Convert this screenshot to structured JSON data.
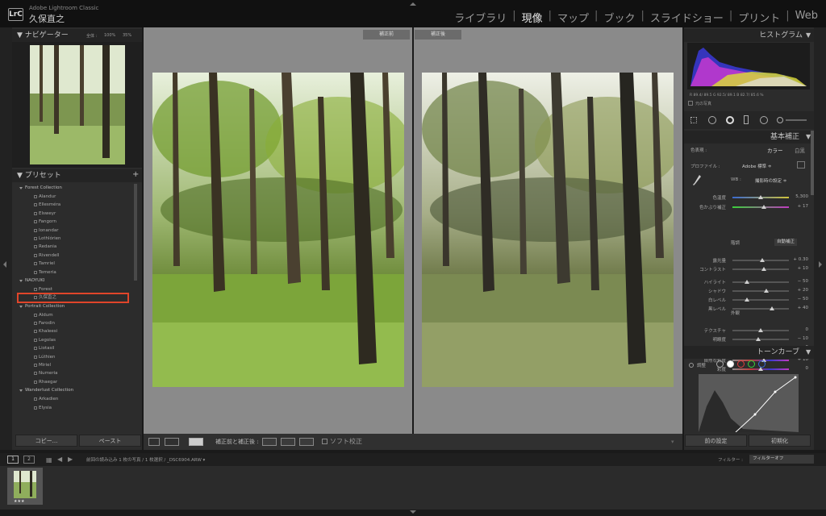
{
  "app": {
    "logo": "LrC",
    "name": "Adobe Lightroom Classic",
    "user": "久保直之"
  },
  "modules": [
    {
      "label": "ライブラリ",
      "active": false
    },
    {
      "label": "現像",
      "active": true
    },
    {
      "label": "マップ",
      "active": false
    },
    {
      "label": "ブック",
      "active": false
    },
    {
      "label": "スライドショー",
      "active": false
    },
    {
      "label": "プリント",
      "active": false
    },
    {
      "label": "Web",
      "active": false
    }
  ],
  "navigator": {
    "title": "ナビゲーター",
    "zoom_fit": "全体 :",
    "zoom_100": "100%",
    "zoom_35": "35%"
  },
  "presets": {
    "title": "プリセット",
    "add": "+",
    "groups": [
      {
        "name": "Forest Collection",
        "items": [
          "Alandur",
          "Ellesméra",
          "Elsweyr",
          "Fangorn",
          "Ionandar",
          "Lothlórien",
          "Redania",
          "Rivendell",
          "Tamriel",
          "Temeria"
        ]
      },
      {
        "name": "NAOYUKI",
        "items": [
          "Forest",
          "久保直之"
        ]
      },
      {
        "name": "Portrait Collection",
        "items": [
          "Aldum",
          "Farodin",
          "Khaleesi",
          "Legolas",
          "Liotasil",
          "Lúthien",
          "Miriel",
          "Numeria",
          "Rhaegar"
        ]
      },
      {
        "name": "Wanderlust Collection",
        "items": [
          "Arkadien",
          "Elysia"
        ]
      }
    ],
    "highlighted": "久保直之"
  },
  "left_buttons": {
    "copy": "コピー...",
    "paste": "ペースト"
  },
  "view": {
    "before_label": "補正前",
    "after_label": "補正後"
  },
  "histogram": {
    "title": "ヒストグラム",
    "rgb_readout": "R 89.4/ 89.5   G 92.5/ 89.1   B 82.7/ 85.6 %",
    "original_photo": "元の写真"
  },
  "basic": {
    "title": "基本補正",
    "treatment_label": "色表現 :",
    "treatment_color": "カラー",
    "treatment_bw": "白黒",
    "profile_label": "プロファイル :",
    "profile_value": "Adobe 標準 ≑",
    "wb_label": "WB :",
    "wb_value": "撮影時の設定 ≑",
    "tone_label": "階調",
    "auto_label": "自動補正",
    "presence_label": "外観",
    "sliders": [
      {
        "name": "色温度",
        "value": "5,300",
        "pos": 0.5
      },
      {
        "name": "色かぶり補正",
        "value": "+ 17",
        "pos": 0.55
      },
      {
        "name": "露光量",
        "value": "+ 0.30",
        "pos": 0.53
      },
      {
        "name": "コントラスト",
        "value": "+ 10",
        "pos": 0.55
      },
      {
        "name": "ハイライト",
        "value": "− 50",
        "pos": 0.25
      },
      {
        "name": "シャドウ",
        "value": "+ 20",
        "pos": 0.6
      },
      {
        "name": "白レベル",
        "value": "− 50",
        "pos": 0.25
      },
      {
        "name": "黒レベル",
        "value": "+ 40",
        "pos": 0.7
      },
      {
        "name": "テクスチャ",
        "value": "0",
        "pos": 0.5
      },
      {
        "name": "明瞭度",
        "value": "− 10",
        "pos": 0.45
      },
      {
        "name": "かすみの除去",
        "value": "0",
        "pos": 0.5
      },
      {
        "name": "自然な彩度",
        "value": "+ 10",
        "pos": 0.55
      },
      {
        "name": "彩度",
        "value": "0",
        "pos": 0.5
      }
    ]
  },
  "tone_curve": {
    "title": "トーンカーブ",
    "adjust_label": "調整"
  },
  "right_buttons": {
    "previous": "前の設定",
    "reset": "初期化"
  },
  "toolbar": {
    "compare_label": "補正前と補正後 :",
    "soft_proof": "ソフト校正"
  },
  "filmbar": {
    "page1": "1",
    "page2": "2",
    "source": "前回の読み込み 1 枚の写真 / 1 枚選択 / _DSC6904.ARW ▾",
    "filter_label": "フィルター :",
    "filter_value": "フィルターオフ"
  },
  "colors": {
    "highlight_box": "#e0452a",
    "accent": "#e6e6e6"
  }
}
